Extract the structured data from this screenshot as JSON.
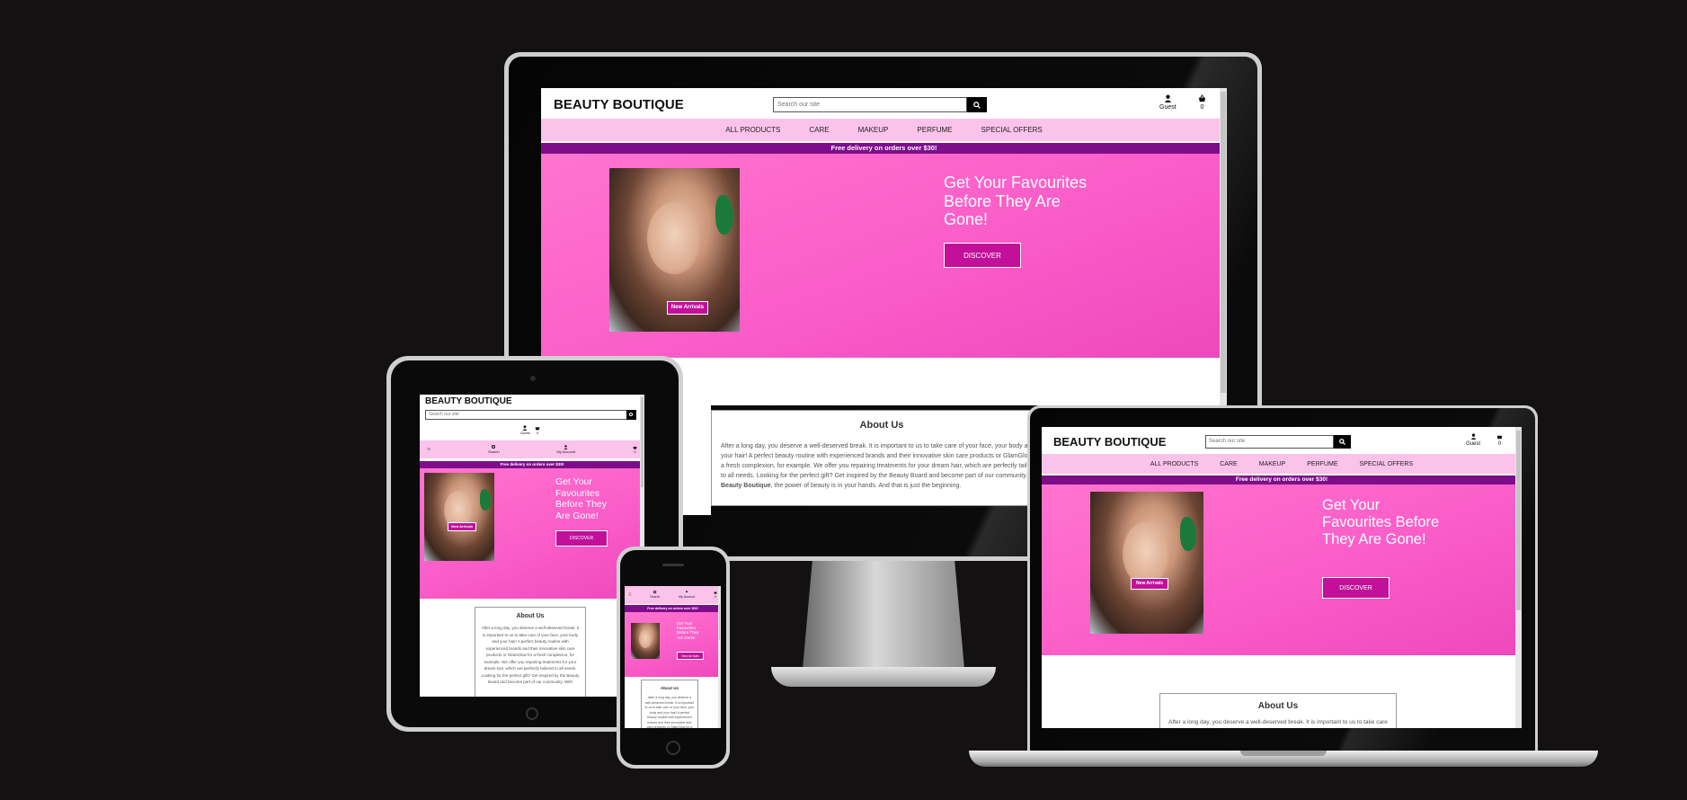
{
  "site": {
    "brand": "BEAUTY BOUTIQUE",
    "search_placeholder": "Search our site",
    "account_label": "Guest",
    "cart_count": "0",
    "nav": [
      "ALL PRODUCTS",
      "CARE",
      "MAKEUP",
      "PERFUME",
      "SPECIAL OFFERS"
    ],
    "promo": "Free delivery on orders over $30!",
    "badge": "New Arrivals",
    "headline": "Get Your Favourites Before They Are Gone!",
    "cta": "DISCOVER",
    "about_title": "About Us",
    "about_text_1": "After a long day, you deserve a well-deserved break. It is important to us to take care of your face, your body and your hair! A perfect beauty routine with experienced brands and their innovative skin care products or GlamGlow for a fresh complexion, for example. We offer you repairing treatments for your dream hair, which are perfectly tailored to all needs. Looking for the perfect gift? Get inspired by the Beauty Board and become part of our community. With ",
    "about_bold": "Beauty Boutique",
    "about_text_2": ", the power of beauty is in your hands. And that is just the beginning.",
    "mobile_search_label": "Search",
    "mobile_account_label": "My Account",
    "menu_icon": "hamburger-icon"
  },
  "colors": {
    "background": "#141113",
    "nav_bg": "#fcc3ea",
    "promo_bg": "#7e0d8a",
    "hero_pink": "#fb5fc9",
    "accent": "#c2109a"
  }
}
